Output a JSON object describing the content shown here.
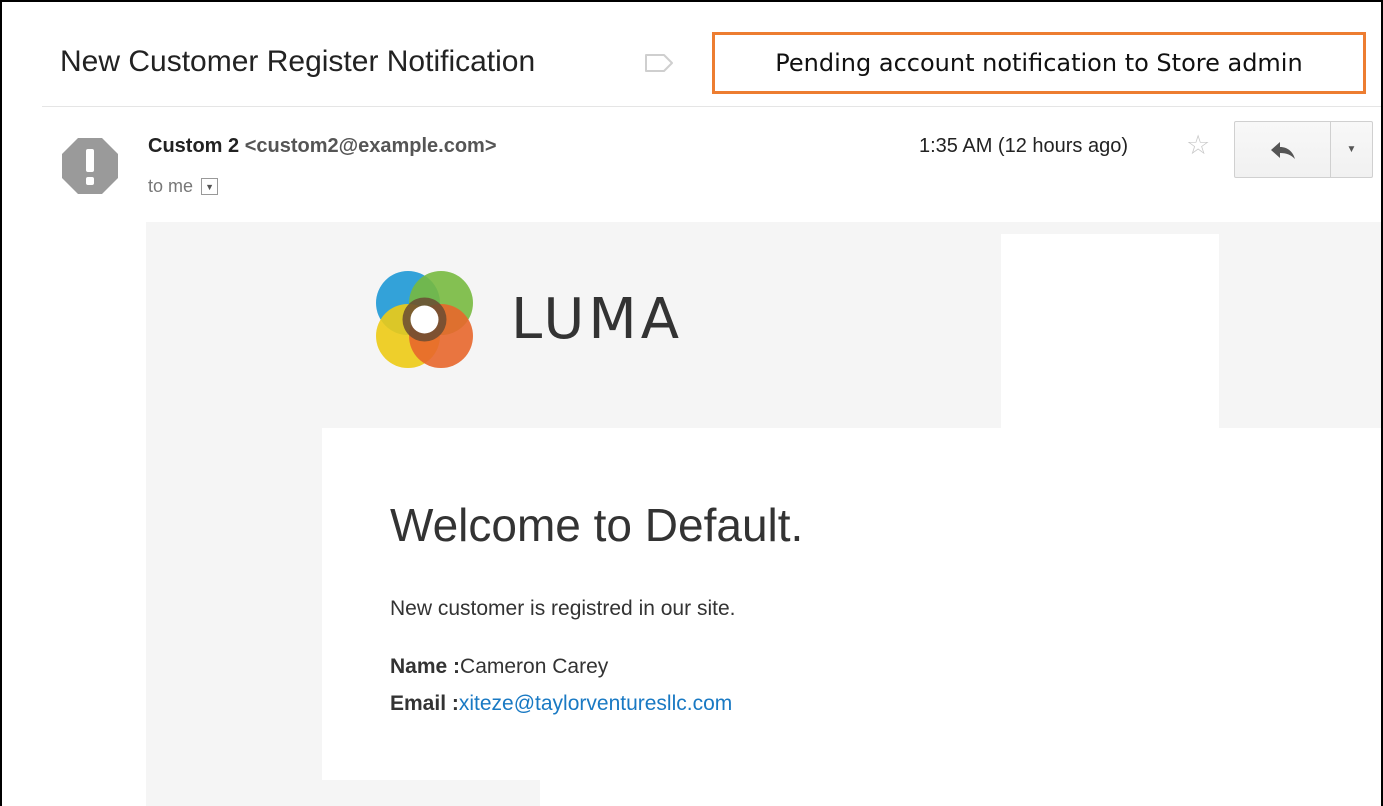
{
  "email": {
    "subject": "New Customer Register Notification",
    "sender_name": "Custom 2",
    "sender_email": "<custom2@example.com>",
    "recipient": "to me",
    "date": "1:35 AM (12 hours ago)"
  },
  "callout": {
    "text": "Pending account notification to Store admin",
    "color": "#ed7d31"
  },
  "message": {
    "logo_text": "LUMA",
    "heading": "Welcome to Default.",
    "intro": "New customer is registred in our site.",
    "name_label": "Name :",
    "name_value": "Cameron Carey",
    "email_label": "Email :",
    "email_value": "xiteze@taylorventuresllc.com",
    "link_color": "#1979c3"
  },
  "icons": {
    "avatar": "alert-octagon-icon",
    "label": "label-tag-icon",
    "star": "star-icon",
    "reply": "reply-arrow-icon",
    "more": "caret-down-icon"
  }
}
